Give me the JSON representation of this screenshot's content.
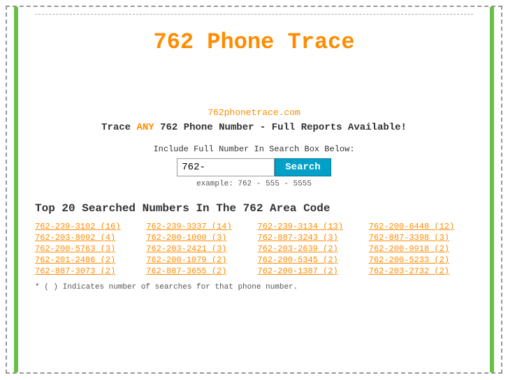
{
  "page": {
    "title": "762 Phone Trace",
    "site_url": "762phonetrace.com",
    "tagline_prefix": "Trace ",
    "tagline_any": "ANY",
    "tagline_suffix": " 762 Phone Number - Full Reports Available!",
    "search_label": "Include Full Number In Search Box Below:",
    "search_placeholder": "762-",
    "search_example": "example: 762 - 555 - 5555",
    "search_button": "Search",
    "top_numbers_title": "Top 20 Searched Numbers In The 762 Area Code",
    "footnote": "* ( ) Indicates number of searches for that phone number.",
    "numbers": [
      "762-239-3102 (16)",
      "762-239-3337 (14)",
      "762-239-3134 (13)",
      "762-200-6448 (12)",
      "762-203-8092 (4)",
      "762-200-1000 (3)",
      "762-887-3243 (3)",
      "762-887-3398 (3)",
      "762-200-5763 (3)",
      "762-203-2421 (3)",
      "762-203-2639 (2)",
      "762-200-9918 (2)",
      "762-201-2486 (2)",
      "762-200-1079 (2)",
      "762-200-5345 (2)",
      "762-200-5233 (2)",
      "762-887-3073 (2)",
      "762-887-3655 (2)",
      "762-200-1387 (2)",
      "762-203-2732 (2)"
    ]
  }
}
